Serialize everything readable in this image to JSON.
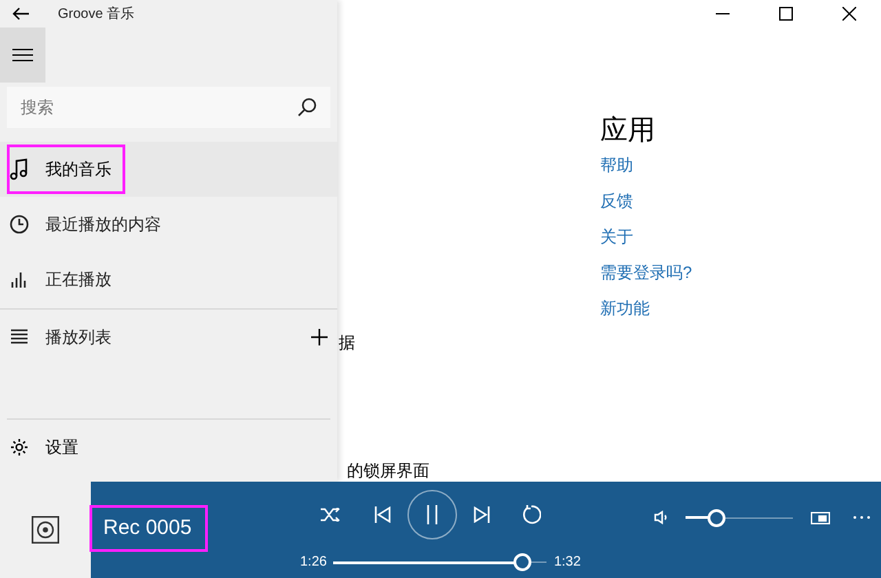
{
  "window": {
    "title": "Groove 音乐"
  },
  "search": {
    "placeholder": "搜索"
  },
  "nav_items": [
    {
      "label": "我的音乐",
      "kind": "music",
      "selected": true,
      "highlighted": true
    },
    {
      "label": "最近播放的内容",
      "kind": "recent",
      "selected": false,
      "highlighted": false
    },
    {
      "label": "正在播放",
      "kind": "nowplaying",
      "selected": false,
      "highlighted": false
    },
    {
      "label": "播放列表",
      "kind": "playlists",
      "selected": false,
      "highlighted": false
    }
  ],
  "settings": {
    "label": "设置"
  },
  "background_texts": [
    "据",
    "的锁屏界面"
  ],
  "app_section": {
    "title": "应用",
    "links": [
      "帮助",
      "反馈",
      "关于",
      "需要登录吗?",
      "新功能"
    ]
  },
  "player": {
    "track": "Rec 0005",
    "track_highlighted": true,
    "elapsed": "1:26",
    "duration": "1:32",
    "progress": {
      "level": 0.88
    },
    "volume": {
      "level": 0.28
    },
    "playing": true
  }
}
